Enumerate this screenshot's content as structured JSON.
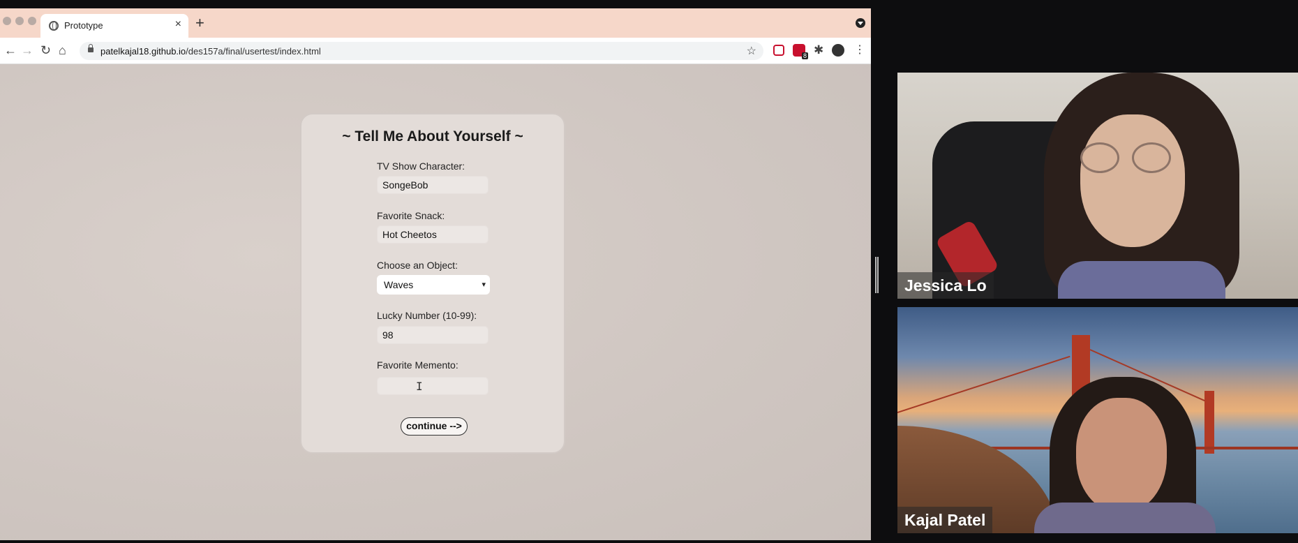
{
  "browser": {
    "tab_title": "Prototype",
    "url_host": "patelkajal18.github.io",
    "url_path": "/des157a/final/usertest/index.html",
    "extension_badge": "8"
  },
  "form": {
    "title": "~ Tell Me About Yourself ~",
    "fields": [
      {
        "label": "TV Show Character:",
        "value": "SongeBob"
      },
      {
        "label": "Favorite Snack:",
        "value": "Hot Cheetos"
      },
      {
        "label": "Choose an Object:",
        "value": "Waves"
      },
      {
        "label": "Lucky Number (10-99):",
        "value": "98"
      },
      {
        "label": "Favorite Memento:",
        "value": ""
      }
    ],
    "continue_label": "continue -->"
  },
  "video_call": {
    "participants": [
      {
        "name": "Jessica Lo"
      },
      {
        "name": "Kajal Patel"
      }
    ]
  },
  "colors": {
    "tab_bar": "#f6d7c9",
    "page_bg": "#d6cdc8",
    "card_bg": "#e3dcd8",
    "extension_red": "#c8102e"
  }
}
